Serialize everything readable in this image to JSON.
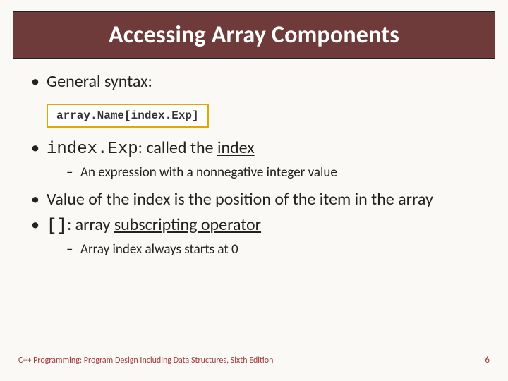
{
  "title": "Accessing Array Components",
  "codebox": "array.Name[index.Exp]",
  "bullets": {
    "b1": "General syntax:",
    "b2_code": "index.Exp",
    "b2_rest": ": called the ",
    "b2_under": "index",
    "b2_sub1": "An expression with a nonnegative integer value",
    "b3": "Value of the index is the position of the item in the array",
    "b4_code": "[]",
    "b4_rest": ": array ",
    "b4_under": "subscripting operator",
    "b4_sub1": "Array index always starts at 0"
  },
  "footer": {
    "left": "C++ Programming: Program Design Including Data Structures, Sixth Edition",
    "page": "6"
  }
}
